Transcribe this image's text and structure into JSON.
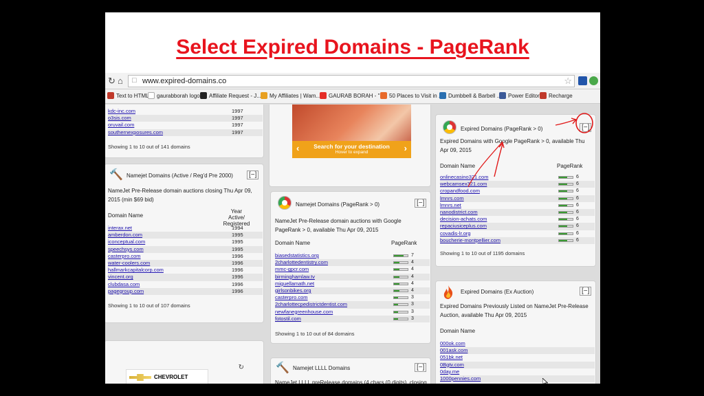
{
  "slide_title": "Select Expired Domains - PageRank",
  "browser": {
    "url": "www.expired-domains.co",
    "bookmarks": [
      "Text to HTML",
      "gaurabborah logo",
      "Affiliate Request - J...",
      "My Affiliates | Wam...",
      "GAURAB BORAH - \"I...",
      "50 Places to Visit in ...",
      "Dumbbell & Barbell ...",
      "Power Editor",
      "Recharge"
    ]
  },
  "top_left_card": {
    "rows": [
      {
        "domain": "kdc-inc.com",
        "year": "1997"
      },
      {
        "domain": "o3sis.com",
        "year": "1997"
      },
      {
        "domain": "oruvail.com",
        "year": "1997"
      },
      {
        "domain": "southernexposures.com",
        "year": "1997"
      }
    ],
    "footer": "Showing 1 to 10 out of 141 domains"
  },
  "namejet_active": {
    "title": "Namejet Domains (Active / Reg'd Pre 2000)",
    "collapse": "[−]",
    "desc": "NameJet Pre-Release domain auctions closing Thu Apr 09, 2015 (min $69 bid)",
    "col_domain": "Domain Name",
    "col_year_1": "Year Active/",
    "col_year_2": "Registered",
    "rows": [
      {
        "domain": "interax.net",
        "year": "1994"
      },
      {
        "domain": "amberdon.com",
        "year": "1995"
      },
      {
        "domain": "iconceptual.com",
        "year": "1995"
      },
      {
        "domain": "speechsys.com",
        "year": "1995"
      },
      {
        "domain": "casterpro.com",
        "year": "1996"
      },
      {
        "domain": "water-coolers.com",
        "year": "1996"
      },
      {
        "domain": "hallmarkcapitalcorp.com",
        "year": "1996"
      },
      {
        "domain": "vincent.org",
        "year": "1996"
      },
      {
        "domain": "clubdasa.com",
        "year": "1996"
      },
      {
        "domain": "pagegroup.com",
        "year": "1996"
      }
    ],
    "footer": "Showing 1 to 10 out of 107 domains"
  },
  "ad": {
    "headline": "Search for your destination",
    "sub": "Hover to expand",
    "brand": "CHEVROLET"
  },
  "namejet_pr": {
    "title": "Namejet Domains (PageRank > 0)",
    "collapse": "[−]",
    "desc": "NameJet Pre-Release domain auctions with Google PageRank > 0, available Thu Apr 09, 2015",
    "col_domain": "Domain Name",
    "col_pr": "PageRank",
    "rows": [
      {
        "domain": "biasedstatistics.org",
        "pr": 7
      },
      {
        "domain": "2charlottedentistry.com",
        "pr": 4
      },
      {
        "domain": "mmc-gpcr.com",
        "pr": 4
      },
      {
        "domain": "birminghamlaw.tv",
        "pr": 4
      },
      {
        "domain": "miguellamath.net",
        "pr": 4
      },
      {
        "domain": "girlsonbikes.org",
        "pr": 4
      },
      {
        "domain": "casterpro.com",
        "pr": 3
      },
      {
        "domain": "2charlottecpedistrictdentist.com",
        "pr": 3
      },
      {
        "domain": "newfanegreenhouse.com",
        "pr": 3
      },
      {
        "domain": "fotostil.com",
        "pr": 3
      }
    ],
    "footer": "Showing 1 to 10 out of 84 domains"
  },
  "namejet_llll": {
    "title": "Namejet LLLL Domains",
    "collapse": "[−]",
    "desc": "NameJet LLLL preRelease domains (4 chars (0 digits), closing"
  },
  "expired_pr": {
    "title": "Expired Domains (PageRank > 0)",
    "collapse": "[−]",
    "desc": "Expired Domains with Google PageRank > 0, available Thu Apr 09, 2015",
    "col_domain": "Domain Name",
    "col_pr": "PageRank",
    "rows": [
      {
        "domain": "onlinecasino321.com",
        "pr": 6
      },
      {
        "domain": "webcamsex321.com",
        "pr": 6
      },
      {
        "domain": "cropandfood.com",
        "pr": 6
      },
      {
        "domain": "lmnrs.com",
        "pr": 6
      },
      {
        "domain": "lmnrs.net",
        "pr": 6
      },
      {
        "domain": "nanodistrict.com",
        "pr": 6
      },
      {
        "domain": "decision-achats.com",
        "pr": 6
      },
      {
        "domain": "repaciusiceplus.com",
        "pr": 6
      },
      {
        "domain": "covadis-lr.org",
        "pr": 6
      },
      {
        "domain": "boucherie-montpellier.com",
        "pr": 6
      }
    ],
    "footer": "Showing 1 to 10 out of 1195 domains"
  },
  "expired_auction": {
    "title": "Expired Domains (Ex Auction)",
    "collapse": "[−]",
    "desc": "Expired Domains Previously Listed on NameJet Pre-Release Auction, available Thu Apr 09, 2015",
    "col_domain": "Domain Name",
    "rows": [
      {
        "domain": "000ok.com"
      },
      {
        "domain": "001ask.com"
      },
      {
        "domain": "051bk.net"
      },
      {
        "domain": "0Bgtv.com"
      },
      {
        "domain": "0day.me"
      },
      {
        "domain": "1000pennies.com"
      }
    ]
  },
  "colors": {
    "title_red": "#e8141e",
    "pr_green": "#3a9a32",
    "link_blue": "#1a0dab"
  }
}
